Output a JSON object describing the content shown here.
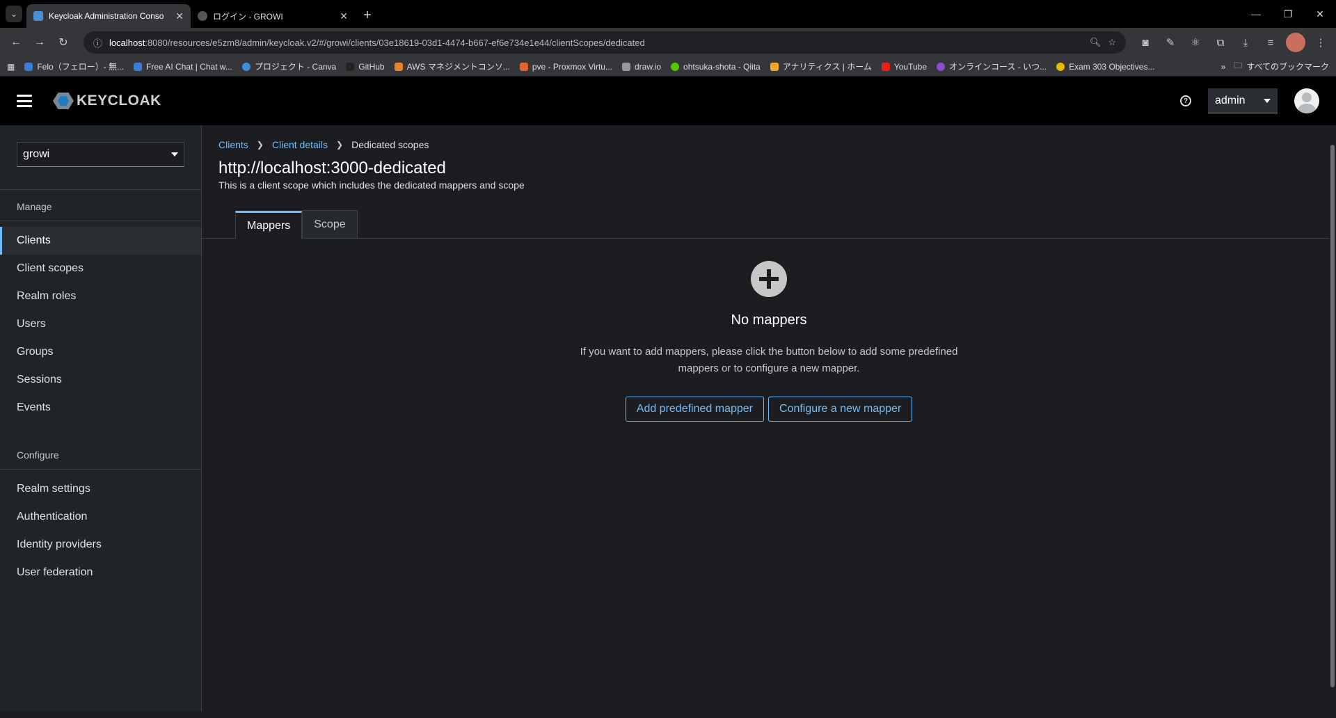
{
  "browser": {
    "tabs": [
      {
        "title": "Keycloak Administration Conso",
        "active": true
      },
      {
        "title": "ログイン - GROWI",
        "active": false
      }
    ],
    "url_host": "localhost",
    "url_rest": ":8080/resources/e5zm8/admin/keycloak.v2/#/growi/clients/03e18619-03d1-4474-b667-ef6e734e1e44/clientScopes/dedicated",
    "bookmarks": [
      "Felo（フェロー）- 無...",
      "Free AI Chat | Chat w...",
      "プロジェクト - Canva",
      "GitHub",
      "AWS マネジメントコンソ...",
      "pve - Proxmox Virtu...",
      "draw.io",
      "ohtsuka-shota - Qiita",
      "アナリティクス | ホーム",
      "YouTube",
      "オンラインコース - いつ...",
      "Exam 303 Objectives..."
    ],
    "bookmarks_folder": "すべてのブックマーク"
  },
  "app": {
    "logo_text": "KEYCLOAK",
    "user": "admin",
    "realm": "growi"
  },
  "sidebar": {
    "manage_title": "Manage",
    "manage_items": [
      "Clients",
      "Client scopes",
      "Realm roles",
      "Users",
      "Groups",
      "Sessions",
      "Events"
    ],
    "configure_title": "Configure",
    "configure_items": [
      "Realm settings",
      "Authentication",
      "Identity providers",
      "User federation"
    ]
  },
  "breadcrumb": {
    "clients": "Clients",
    "client_details": "Client details",
    "current": "Dedicated scopes"
  },
  "page": {
    "title": "http://localhost:3000-dedicated",
    "description": "This is a client scope which includes the dedicated mappers and scope",
    "tabs": [
      "Mappers",
      "Scope"
    ],
    "empty_title": "No mappers",
    "empty_body": "If you want to add mappers, please click the button below to add some predefined mappers or to configure a new mapper.",
    "add_predefined": "Add predefined mapper",
    "configure_new": "Configure a new mapper"
  }
}
